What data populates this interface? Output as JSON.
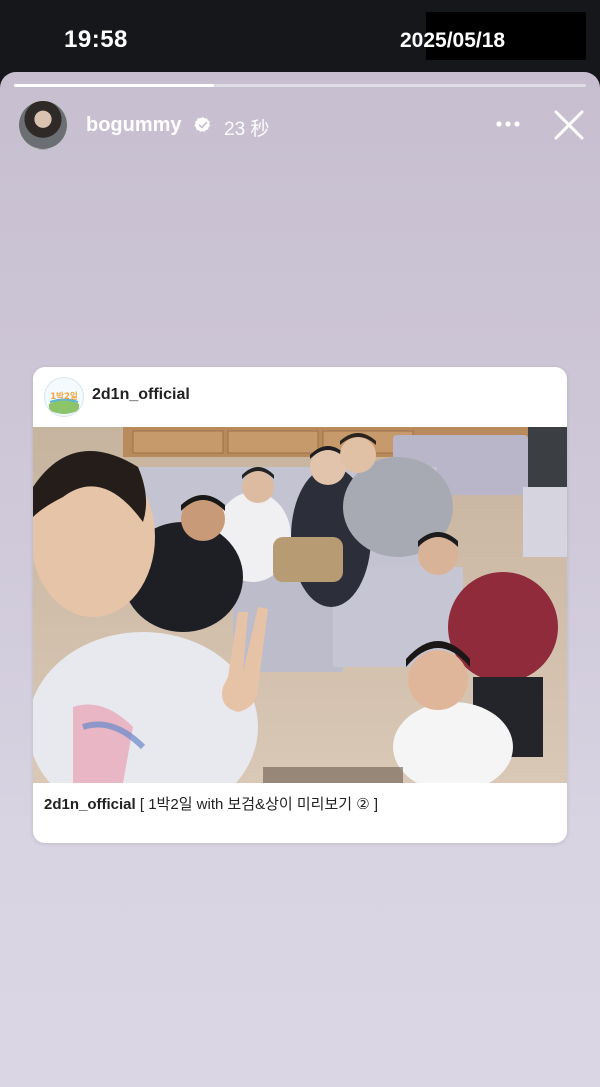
{
  "status_bar": {
    "time": "19:58",
    "date": "2025/05/18"
  },
  "story": {
    "progress": 0.35,
    "username": "bogummy",
    "verified": true,
    "time_ago": "23 秒",
    "more_icon": "more-horizontal-icon",
    "close_icon": "close-icon"
  },
  "shared_post": {
    "username": "2d1n_official",
    "avatar_logo_text": "1박2일",
    "caption_username": "2d1n_official",
    "caption_text": "[ 1박2일 with 보검&상이 미리보기 ② ]"
  },
  "colors": {
    "background_top": "#c7bfd0",
    "background_bottom": "#dad6e3",
    "status_bar": "#15171b",
    "verified_badge": "#ffffff"
  }
}
